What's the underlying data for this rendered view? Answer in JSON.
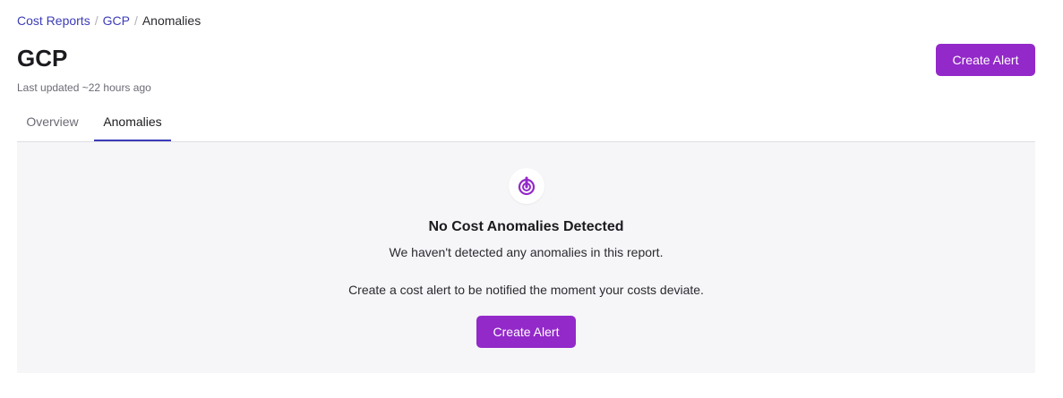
{
  "breadcrumb": {
    "items": [
      "Cost Reports",
      "GCP"
    ],
    "separator": "/",
    "current": "Anomalies"
  },
  "header": {
    "title": "GCP",
    "last_updated": "Last updated ~22 hours ago",
    "create_alert_label": "Create Alert"
  },
  "tabs": [
    {
      "label": "Overview",
      "active": false
    },
    {
      "label": "Anomalies",
      "active": true
    }
  ],
  "empty_state": {
    "icon": "target-pointer-icon",
    "title": "No Cost Anomalies Detected",
    "message": "We haven't detected any anomalies in this report.",
    "cta_text": "Create a cost alert to be notified the moment your costs deviate.",
    "button_label": "Create Alert"
  },
  "colors": {
    "accent": "#9329c9",
    "link": "#3c3cb8",
    "panel_bg": "#f6f6f8"
  }
}
